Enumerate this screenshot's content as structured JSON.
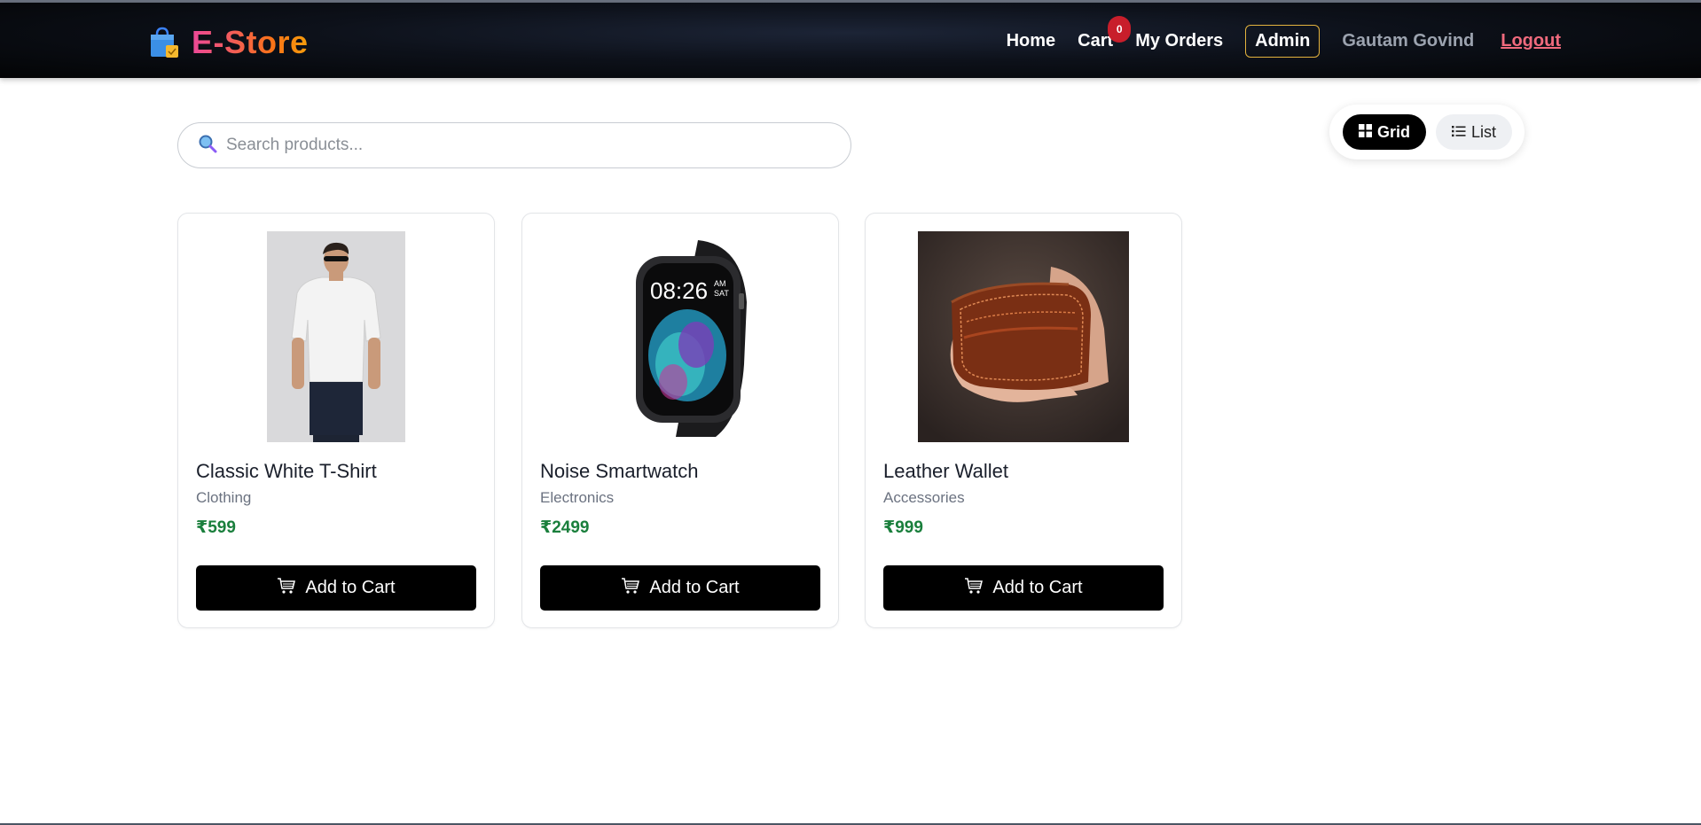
{
  "brand": {
    "name": "E-Store"
  },
  "nav": {
    "home": "Home",
    "cart": "Cart",
    "cart_count": "0",
    "orders": "My Orders",
    "admin": "Admin",
    "user": "Gautam Govind",
    "logout": "Logout"
  },
  "search": {
    "placeholder": "Search products..."
  },
  "view": {
    "grid": "Grid",
    "list": "List",
    "selected": "Grid"
  },
  "products": [
    {
      "name": "Classic White T-Shirt",
      "category": "Clothing",
      "price": "₹599",
      "button": "Add to Cart",
      "image": "white-tshirt-photo"
    },
    {
      "name": "Noise Smartwatch",
      "category": "Electronics",
      "price": "₹2499",
      "button": "Add to Cart",
      "image": "smartwatch-photo",
      "watch_time": "08:26",
      "watch_ampm": "AM",
      "watch_day": "SAT"
    },
    {
      "name": "Leather Wallet",
      "category": "Accessories",
      "price": "₹999",
      "button": "Add to Cart",
      "image": "leather-wallet-photo"
    }
  ],
  "colors": {
    "price": "#1a7f3c",
    "badge": "#c81e2b",
    "admin_border": "#e4b33e",
    "logout": "#f06a7d"
  }
}
